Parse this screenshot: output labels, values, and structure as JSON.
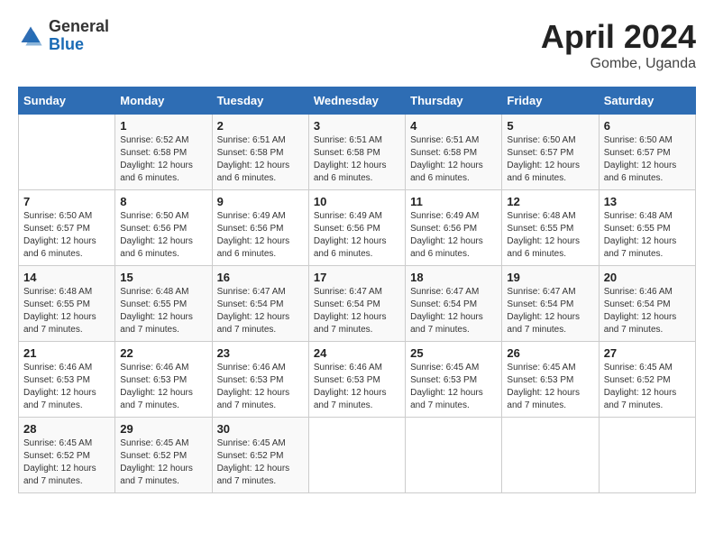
{
  "header": {
    "logo_general": "General",
    "logo_blue": "Blue",
    "month_title": "April 2024",
    "location": "Gombe, Uganda"
  },
  "days_of_week": [
    "Sunday",
    "Monday",
    "Tuesday",
    "Wednesday",
    "Thursday",
    "Friday",
    "Saturday"
  ],
  "weeks": [
    [
      {
        "day": "",
        "sunrise": "",
        "sunset": "",
        "daylight": ""
      },
      {
        "day": "1",
        "sunrise": "Sunrise: 6:52 AM",
        "sunset": "Sunset: 6:58 PM",
        "daylight": "Daylight: 12 hours and 6 minutes."
      },
      {
        "day": "2",
        "sunrise": "Sunrise: 6:51 AM",
        "sunset": "Sunset: 6:58 PM",
        "daylight": "Daylight: 12 hours and 6 minutes."
      },
      {
        "day": "3",
        "sunrise": "Sunrise: 6:51 AM",
        "sunset": "Sunset: 6:58 PM",
        "daylight": "Daylight: 12 hours and 6 minutes."
      },
      {
        "day": "4",
        "sunrise": "Sunrise: 6:51 AM",
        "sunset": "Sunset: 6:58 PM",
        "daylight": "Daylight: 12 hours and 6 minutes."
      },
      {
        "day": "5",
        "sunrise": "Sunrise: 6:50 AM",
        "sunset": "Sunset: 6:57 PM",
        "daylight": "Daylight: 12 hours and 6 minutes."
      },
      {
        "day": "6",
        "sunrise": "Sunrise: 6:50 AM",
        "sunset": "Sunset: 6:57 PM",
        "daylight": "Daylight: 12 hours and 6 minutes."
      }
    ],
    [
      {
        "day": "7",
        "sunrise": "Sunrise: 6:50 AM",
        "sunset": "Sunset: 6:57 PM",
        "daylight": "Daylight: 12 hours and 6 minutes."
      },
      {
        "day": "8",
        "sunrise": "Sunrise: 6:50 AM",
        "sunset": "Sunset: 6:56 PM",
        "daylight": "Daylight: 12 hours and 6 minutes."
      },
      {
        "day": "9",
        "sunrise": "Sunrise: 6:49 AM",
        "sunset": "Sunset: 6:56 PM",
        "daylight": "Daylight: 12 hours and 6 minutes."
      },
      {
        "day": "10",
        "sunrise": "Sunrise: 6:49 AM",
        "sunset": "Sunset: 6:56 PM",
        "daylight": "Daylight: 12 hours and 6 minutes."
      },
      {
        "day": "11",
        "sunrise": "Sunrise: 6:49 AM",
        "sunset": "Sunset: 6:56 PM",
        "daylight": "Daylight: 12 hours and 6 minutes."
      },
      {
        "day": "12",
        "sunrise": "Sunrise: 6:48 AM",
        "sunset": "Sunset: 6:55 PM",
        "daylight": "Daylight: 12 hours and 6 minutes."
      },
      {
        "day": "13",
        "sunrise": "Sunrise: 6:48 AM",
        "sunset": "Sunset: 6:55 PM",
        "daylight": "Daylight: 12 hours and 7 minutes."
      }
    ],
    [
      {
        "day": "14",
        "sunrise": "Sunrise: 6:48 AM",
        "sunset": "Sunset: 6:55 PM",
        "daylight": "Daylight: 12 hours and 7 minutes."
      },
      {
        "day": "15",
        "sunrise": "Sunrise: 6:48 AM",
        "sunset": "Sunset: 6:55 PM",
        "daylight": "Daylight: 12 hours and 7 minutes."
      },
      {
        "day": "16",
        "sunrise": "Sunrise: 6:47 AM",
        "sunset": "Sunset: 6:54 PM",
        "daylight": "Daylight: 12 hours and 7 minutes."
      },
      {
        "day": "17",
        "sunrise": "Sunrise: 6:47 AM",
        "sunset": "Sunset: 6:54 PM",
        "daylight": "Daylight: 12 hours and 7 minutes."
      },
      {
        "day": "18",
        "sunrise": "Sunrise: 6:47 AM",
        "sunset": "Sunset: 6:54 PM",
        "daylight": "Daylight: 12 hours and 7 minutes."
      },
      {
        "day": "19",
        "sunrise": "Sunrise: 6:47 AM",
        "sunset": "Sunset: 6:54 PM",
        "daylight": "Daylight: 12 hours and 7 minutes."
      },
      {
        "day": "20",
        "sunrise": "Sunrise: 6:46 AM",
        "sunset": "Sunset: 6:54 PM",
        "daylight": "Daylight: 12 hours and 7 minutes."
      }
    ],
    [
      {
        "day": "21",
        "sunrise": "Sunrise: 6:46 AM",
        "sunset": "Sunset: 6:53 PM",
        "daylight": "Daylight: 12 hours and 7 minutes."
      },
      {
        "day": "22",
        "sunrise": "Sunrise: 6:46 AM",
        "sunset": "Sunset: 6:53 PM",
        "daylight": "Daylight: 12 hours and 7 minutes."
      },
      {
        "day": "23",
        "sunrise": "Sunrise: 6:46 AM",
        "sunset": "Sunset: 6:53 PM",
        "daylight": "Daylight: 12 hours and 7 minutes."
      },
      {
        "day": "24",
        "sunrise": "Sunrise: 6:46 AM",
        "sunset": "Sunset: 6:53 PM",
        "daylight": "Daylight: 12 hours and 7 minutes."
      },
      {
        "day": "25",
        "sunrise": "Sunrise: 6:45 AM",
        "sunset": "Sunset: 6:53 PM",
        "daylight": "Daylight: 12 hours and 7 minutes."
      },
      {
        "day": "26",
        "sunrise": "Sunrise: 6:45 AM",
        "sunset": "Sunset: 6:53 PM",
        "daylight": "Daylight: 12 hours and 7 minutes."
      },
      {
        "day": "27",
        "sunrise": "Sunrise: 6:45 AM",
        "sunset": "Sunset: 6:52 PM",
        "daylight": "Daylight: 12 hours and 7 minutes."
      }
    ],
    [
      {
        "day": "28",
        "sunrise": "Sunrise: 6:45 AM",
        "sunset": "Sunset: 6:52 PM",
        "daylight": "Daylight: 12 hours and 7 minutes."
      },
      {
        "day": "29",
        "sunrise": "Sunrise: 6:45 AM",
        "sunset": "Sunset: 6:52 PM",
        "daylight": "Daylight: 12 hours and 7 minutes."
      },
      {
        "day": "30",
        "sunrise": "Sunrise: 6:45 AM",
        "sunset": "Sunset: 6:52 PM",
        "daylight": "Daylight: 12 hours and 7 minutes."
      },
      {
        "day": "",
        "sunrise": "",
        "sunset": "",
        "daylight": ""
      },
      {
        "day": "",
        "sunrise": "",
        "sunset": "",
        "daylight": ""
      },
      {
        "day": "",
        "sunrise": "",
        "sunset": "",
        "daylight": ""
      },
      {
        "day": "",
        "sunrise": "",
        "sunset": "",
        "daylight": ""
      }
    ]
  ]
}
